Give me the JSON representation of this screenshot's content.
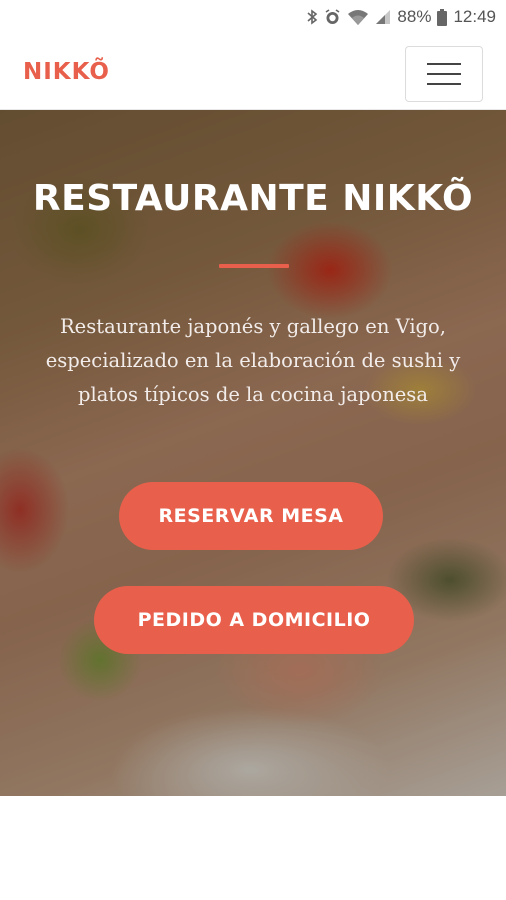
{
  "status_bar": {
    "battery": "88%",
    "time": "12:49",
    "icons": [
      "bluetooth-icon",
      "alarm-icon",
      "wifi-icon",
      "signal-icon",
      "battery-icon"
    ]
  },
  "navbar": {
    "brand": "NIKKÕ",
    "menu_icon": "hamburger-menu-icon"
  },
  "hero": {
    "title": "RESTAURANTE NIKKÕ",
    "subtitle": "Restaurante japonés y gallego en Vigo, especializado en la elaboración de sushi y platos típicos de la cocina japonesa",
    "buttons": {
      "reserve": "RESERVAR MESA",
      "delivery": "PEDIDO A DOMICILIO"
    }
  },
  "colors": {
    "accent": "#e8604c",
    "hero_text": "#ffffff"
  }
}
